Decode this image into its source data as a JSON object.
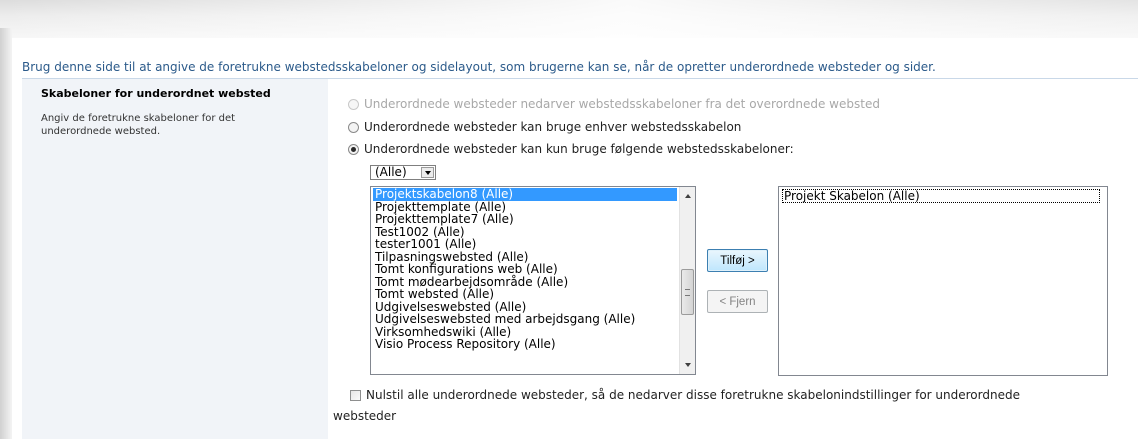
{
  "intro_text": "Brug denne side til at angive de foretrukne webstedsskabeloner og sidelayout, som brugerne kan se, når de opretter underordnede websteder og sider.",
  "section": {
    "title": "Skabeloner for underordnet websted",
    "description": "Angiv de foretrukne skabeloner for det underordnede websted."
  },
  "options": {
    "inherit": "Underordnede websteder nedarver webstedsskabeloner fra det overordnede websted",
    "any": "Underordnede websteder kan bruge enhver webstedsskabelon",
    "only": "Underordnede websteder kan kun bruge følgende webstedsskabeloner:",
    "selected": "only"
  },
  "language_filter": "(Alle)",
  "available_templates": [
    "Projektskabelon8 (Alle)",
    "Projekttemplate (Alle)",
    "Projekttemplate7 (Alle)",
    "Test1002 (Alle)",
    "tester1001 (Alle)",
    "Tilpasningswebsted (Alle)",
    "Tomt konfigurations web (Alle)",
    "Tomt mødearbejdsområde (Alle)",
    "Tomt websted (Alle)",
    "Udgivelseswebsted (Alle)",
    "Udgivelseswebsted med arbejdsgang (Alle)",
    "Virksomhedswiki (Alle)",
    "Visio Process Repository (Alle)"
  ],
  "selected_available": "Projektskabelon8 (Alle)",
  "chosen_templates": [
    "Projekt Skabelon (Alle)"
  ],
  "buttons": {
    "add": "Tilføj >",
    "remove": "< Fjern"
  },
  "reset_checkbox": {
    "label_line1": "Nulstil alle underordnede websteder, så de nedarver disse foretrukne skabelonindstillinger for underordnede",
    "label_line2": "websteder",
    "checked": false
  }
}
